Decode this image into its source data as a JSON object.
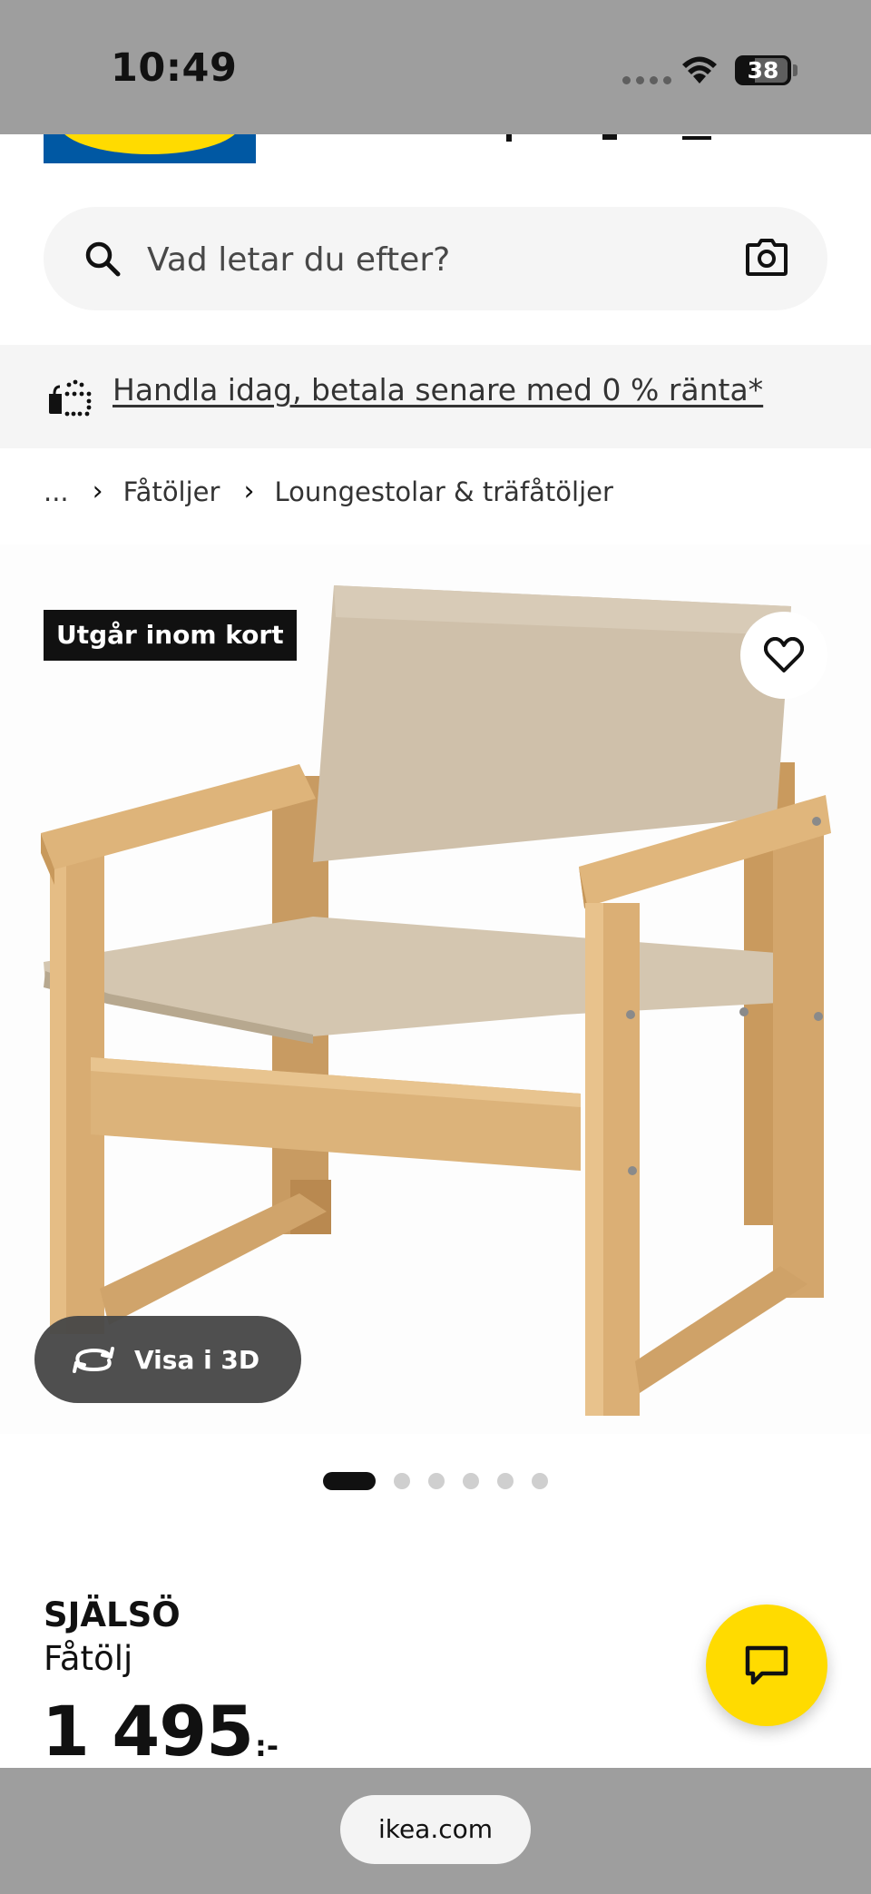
{
  "status_bar": {
    "time": "10:49",
    "battery": "38"
  },
  "search": {
    "placeholder": "Vad letar du efter?"
  },
  "promo": {
    "text": "Handla idag, betala senare med 0 % ränta*"
  },
  "breadcrumb": {
    "items": [
      "...",
      "Fåtöljer",
      "Loungestolar & träfåtöljer"
    ]
  },
  "product": {
    "badge": "Utgår inom kort",
    "view_3d_label": "Visa i 3D",
    "carousel": {
      "total": 6,
      "active": 1
    },
    "name": "SJÄLSÖ",
    "type": "Fåtölj",
    "price": "1 495",
    "price_suffix": ":-"
  },
  "browser": {
    "url": "ikea.com"
  },
  "colors": {
    "brand_blue": "#0058a3",
    "brand_yellow": "#ffdb00",
    "badge_bg": "#111111"
  }
}
